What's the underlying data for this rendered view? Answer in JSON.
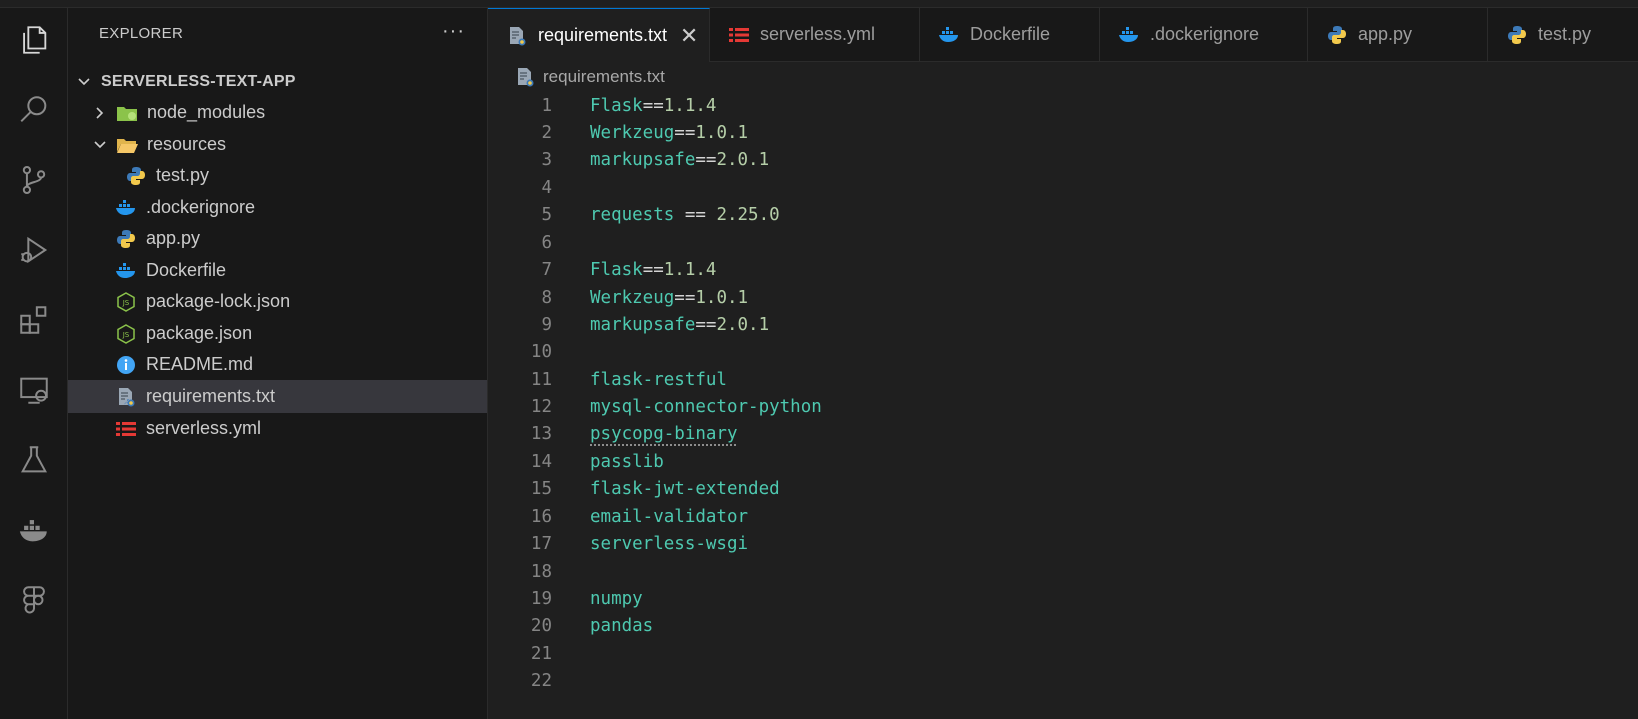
{
  "sidebar": {
    "title": "EXPLORER",
    "more": "···",
    "root": "SERVERLESS-TEXT-APP",
    "items": [
      {
        "label": "node_modules",
        "icon": "folder-node-icon"
      },
      {
        "label": "resources",
        "icon": "folder-open-icon"
      },
      {
        "label": "test.py",
        "icon": "python-icon"
      },
      {
        "label": ".dockerignore",
        "icon": "docker-icon"
      },
      {
        "label": "app.py",
        "icon": "python-icon"
      },
      {
        "label": "Dockerfile",
        "icon": "docker-icon"
      },
      {
        "label": "package-lock.json",
        "icon": "json-js-icon"
      },
      {
        "label": "package.json",
        "icon": "json-js-icon"
      },
      {
        "label": "README.md",
        "icon": "info-icon"
      },
      {
        "label": "requirements.txt",
        "icon": "requirements-file-icon"
      },
      {
        "label": "serverless.yml",
        "icon": "serverless-icon"
      }
    ]
  },
  "tabs": [
    {
      "label": "requirements.txt",
      "active": true
    },
    {
      "label": "serverless.yml"
    },
    {
      "label": "Dockerfile"
    },
    {
      "label": ".dockerignore"
    },
    {
      "label": "app.py"
    },
    {
      "label": "test.py"
    }
  ],
  "close_glyph": "✕",
  "breadcrumb": "requirements.txt",
  "editor": {
    "lines": [
      {
        "n": "1",
        "pkg": "Flask",
        "op": "==",
        "ver": "1.1.4"
      },
      {
        "n": "2",
        "pkg": "Werkzeug",
        "op": "==",
        "ver": "1.0.1"
      },
      {
        "n": "3",
        "pkg": "markupsafe",
        "op": "==",
        "ver": "2.0.1"
      },
      {
        "n": "4",
        "pkg": "",
        "op": "",
        "ver": ""
      },
      {
        "n": "5",
        "pkg": "requests",
        "op": " == ",
        "ver": "2.25.0"
      },
      {
        "n": "6",
        "pkg": "",
        "op": "",
        "ver": ""
      },
      {
        "n": "7",
        "pkg": "Flask",
        "op": "==",
        "ver": "1.1.4"
      },
      {
        "n": "8",
        "pkg": "Werkzeug",
        "op": "==",
        "ver": "1.0.1"
      },
      {
        "n": "9",
        "pkg": "markupsafe",
        "op": "==",
        "ver": "2.0.1"
      },
      {
        "n": "10",
        "pkg": "",
        "op": "",
        "ver": ""
      },
      {
        "n": "11",
        "pkg": "flask-restful",
        "op": "",
        "ver": ""
      },
      {
        "n": "12",
        "pkg": "mysql-connector-python",
        "op": "",
        "ver": ""
      },
      {
        "n": "13",
        "pkg": "psycopg-binary",
        "op": "",
        "ver": ""
      },
      {
        "n": "14",
        "pkg": "passlib",
        "op": "",
        "ver": ""
      },
      {
        "n": "15",
        "pkg": "flask-jwt-extended",
        "op": "",
        "ver": ""
      },
      {
        "n": "16",
        "pkg": "email-validator",
        "op": "",
        "ver": ""
      },
      {
        "n": "17",
        "pkg": "serverless-wsgi",
        "op": "",
        "ver": ""
      },
      {
        "n": "18",
        "pkg": "",
        "op": "",
        "ver": ""
      },
      {
        "n": "19",
        "pkg": "numpy",
        "op": "",
        "ver": ""
      },
      {
        "n": "20",
        "pkg": "pandas",
        "op": "",
        "ver": ""
      },
      {
        "n": "21",
        "pkg": "",
        "op": "",
        "ver": ""
      },
      {
        "n": "22",
        "pkg": "",
        "op": "",
        "ver": ""
      }
    ]
  },
  "colors": {
    "accent": "#0078d4",
    "package": "#4ec9b0",
    "version": "#b5cea8",
    "selection": "#37373d"
  }
}
